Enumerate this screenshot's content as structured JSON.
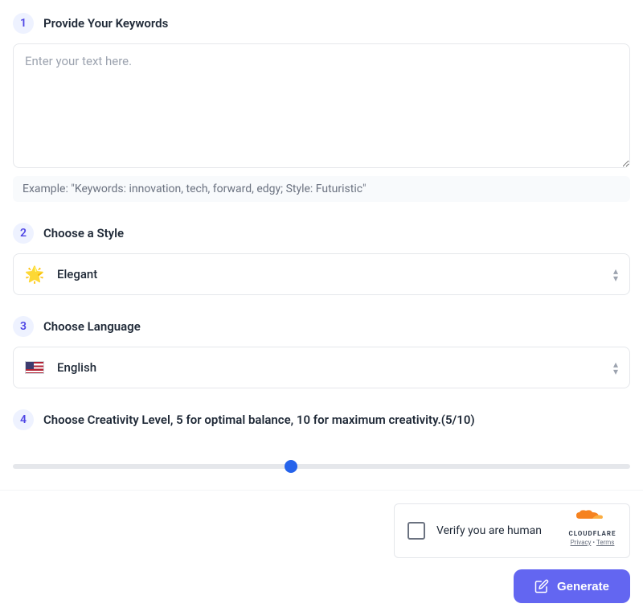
{
  "steps": {
    "keywords": {
      "num": "1",
      "title": "Provide Your Keywords",
      "placeholder": "Enter your text here.",
      "example_prefix": "Example:  ",
      "example_text": "\"Keywords: innovation, tech, forward, edgy; Style: Futuristic\""
    },
    "style": {
      "num": "2",
      "title": "Choose a Style",
      "selected_label": "Elegant",
      "selected_icon": "🌟"
    },
    "language": {
      "num": "3",
      "title": "Choose Language",
      "selected_label": "English"
    },
    "creativity": {
      "num": "4",
      "title": "Choose Creativity Level, 5 for optimal balance, 10 for maximum creativity.(5/10)",
      "value": 5,
      "min": 1,
      "max": 10
    }
  },
  "captcha": {
    "text": "Verify you are human",
    "brand": "CLOUDFLARE",
    "privacy": "Privacy",
    "terms": "Terms"
  },
  "generate": {
    "label": "Generate"
  }
}
